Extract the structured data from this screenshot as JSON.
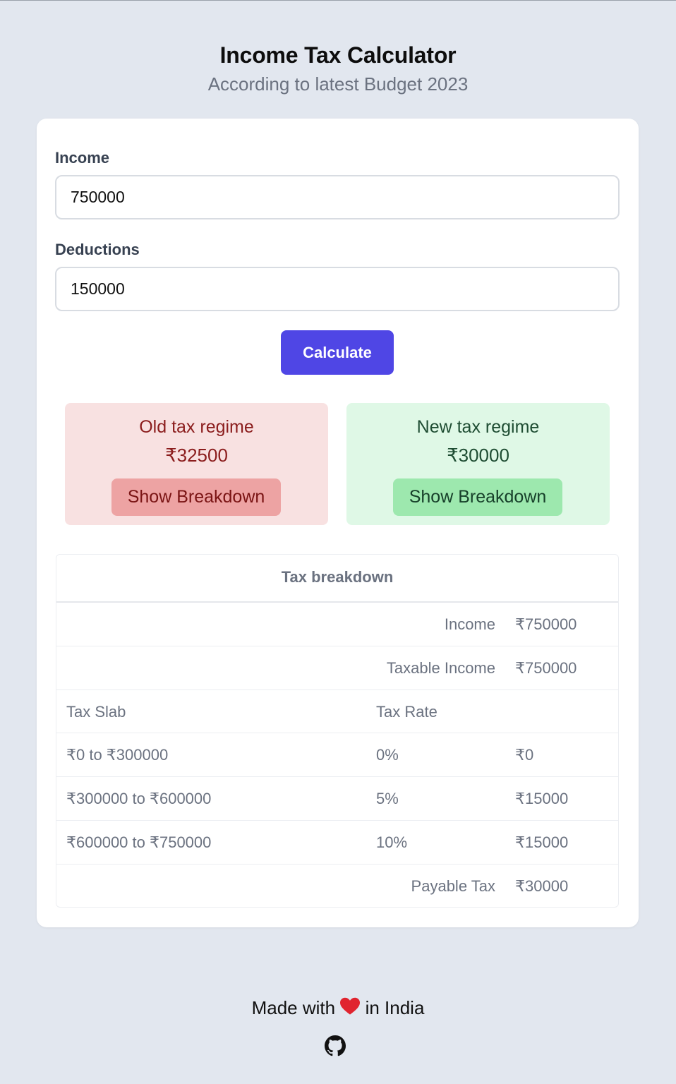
{
  "header": {
    "title": "Income Tax Calculator",
    "subtitle": "According to latest Budget 2023"
  },
  "form": {
    "income_label": "Income",
    "income_value": "750000",
    "deductions_label": "Deductions",
    "deductions_value": "150000",
    "calculate_label": "Calculate"
  },
  "regimes": {
    "old": {
      "title": "Old tax regime",
      "amount": "₹32500",
      "button_label": "Show Breakdown",
      "colors": {
        "background": "#f8e1e1",
        "button": "#eda3a3",
        "text": "#8b1d1d"
      }
    },
    "new": {
      "title": "New tax regime",
      "amount": "₹30000",
      "button_label": "Show Breakdown",
      "colors": {
        "background": "#dff8e6",
        "button": "#9de8ae",
        "text": "#1f4d33"
      }
    }
  },
  "breakdown": {
    "caption": "Tax breakdown",
    "income_label": "Income",
    "income_value": "₹750000",
    "taxable_label": "Taxable Income",
    "taxable_value": "₹750000",
    "col_slab": "Tax Slab",
    "col_rate": "Tax Rate",
    "rows": [
      {
        "slab": "₹0 to ₹300000",
        "rate": "0%",
        "tax": "₹0"
      },
      {
        "slab": "₹300000 to ₹600000",
        "rate": "5%",
        "tax": "₹15000"
      },
      {
        "slab": "₹600000 to ₹750000",
        "rate": "10%",
        "tax": "₹15000"
      }
    ],
    "payable_label": "Payable Tax",
    "payable_value": "₹30000"
  },
  "footer": {
    "text_before": "Made with",
    "text_after": "in India",
    "heart_icon": "heart-icon",
    "github_icon": "github-icon"
  },
  "colors": {
    "page_background": "#e2e7ef",
    "accent": "#4f46e5"
  }
}
